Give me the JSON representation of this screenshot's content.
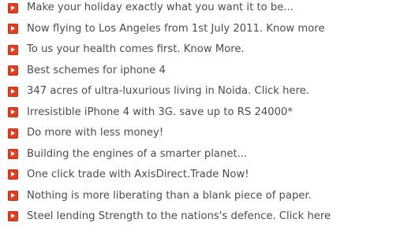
{
  "ads": {
    "items": [
      {
        "text": "Make your holiday exactly what you want it to be...",
        "icon": "arrow-right-icon"
      },
      {
        "text": "Now flying to Los Angeles from 1st July 2011. Know more",
        "icon": "arrow-right-icon"
      },
      {
        "text": "To us your health comes first. Know More.",
        "icon": "arrow-right-icon"
      },
      {
        "text": "Best schemes for iphone 4",
        "icon": "arrow-right-icon"
      },
      {
        "text": "347 acres of ultra-luxurious living in Noida. Click here.",
        "icon": "arrow-right-icon"
      },
      {
        "text": "Irresistible iPhone 4 with 3G. save up to RS 24000*",
        "icon": "arrow-right-icon"
      },
      {
        "text": "Do more with less money!",
        "icon": "arrow-right-icon"
      },
      {
        "text": "Building the engines of a smarter planet...",
        "icon": "arrow-right-icon"
      },
      {
        "text": "One click trade with AxisDirect.Trade Now!",
        "icon": "arrow-right-icon"
      },
      {
        "text": "Nothing is more liberating than a blank piece of paper.",
        "icon": "arrow-right-icon"
      },
      {
        "text": "Steel lending Strength to the nations's defence. Click here",
        "icon": "arrow-right-icon"
      }
    ],
    "colors": {
      "bullet": "#e04020",
      "link_text": "#4d4d4d"
    }
  }
}
